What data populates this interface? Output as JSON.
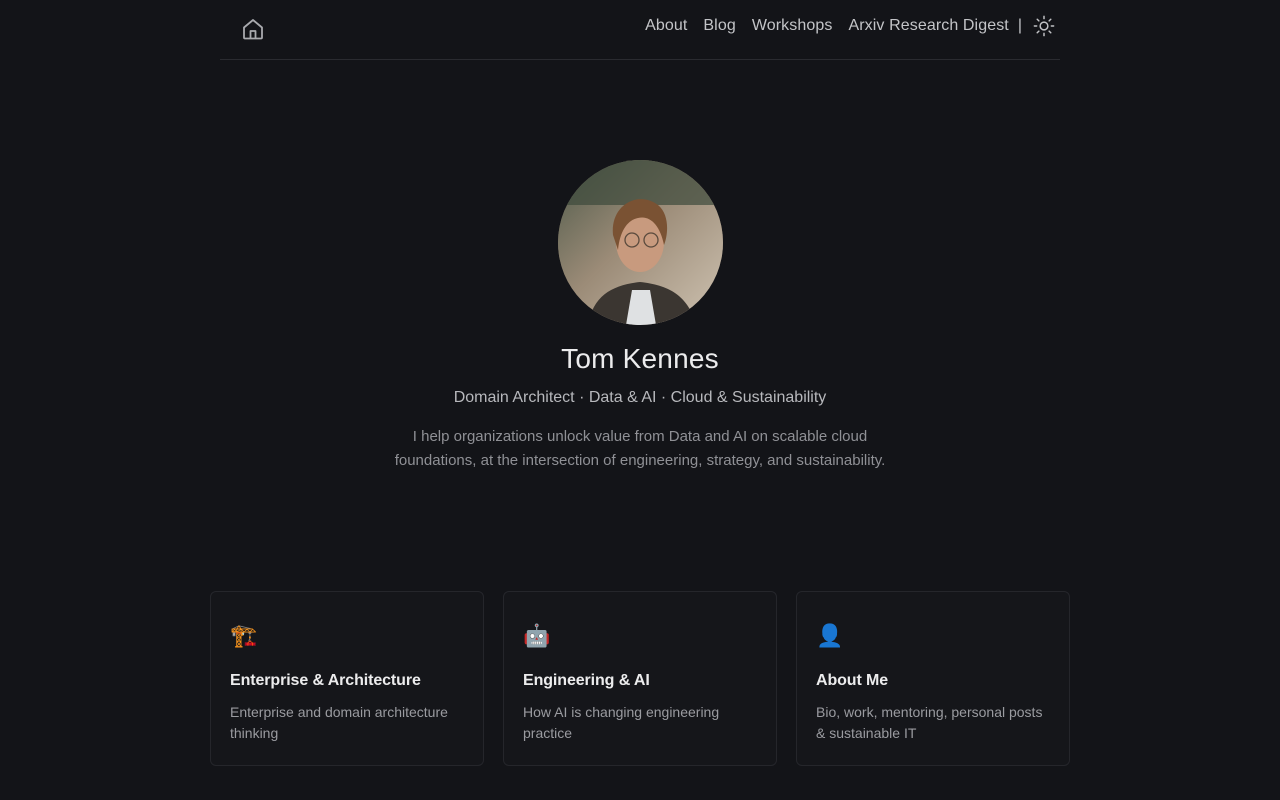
{
  "header": {
    "home_icon": "home-icon",
    "nav": [
      {
        "label": "About"
      },
      {
        "label": "Blog"
      },
      {
        "label": "Workshops"
      },
      {
        "label": "Arxiv Research Digest"
      }
    ],
    "separator": "|",
    "theme_icon": "sun-icon"
  },
  "hero": {
    "name": "Tom Kennes",
    "tagline": "Domain Architect · Data & AI · Cloud & Sustainability",
    "bio": "I help organizations unlock value from Data and AI on scalable cloud foundations, at the intersection of engineering, strategy, and sustainability."
  },
  "cards": [
    {
      "emoji": "🏗️",
      "icon": "construction-crane-icon",
      "title": "Enterprise & Architecture",
      "desc": "Enterprise and domain architecture thinking"
    },
    {
      "emoji": "🤖",
      "icon": "robot-icon",
      "title": "Engineering & AI",
      "desc": "How AI is changing engineering practice"
    },
    {
      "emoji": "👤",
      "icon": "person-silhouette-icon",
      "title": "About Me",
      "desc": "Bio, work, mentoring, personal posts & sustainable IT"
    }
  ]
}
